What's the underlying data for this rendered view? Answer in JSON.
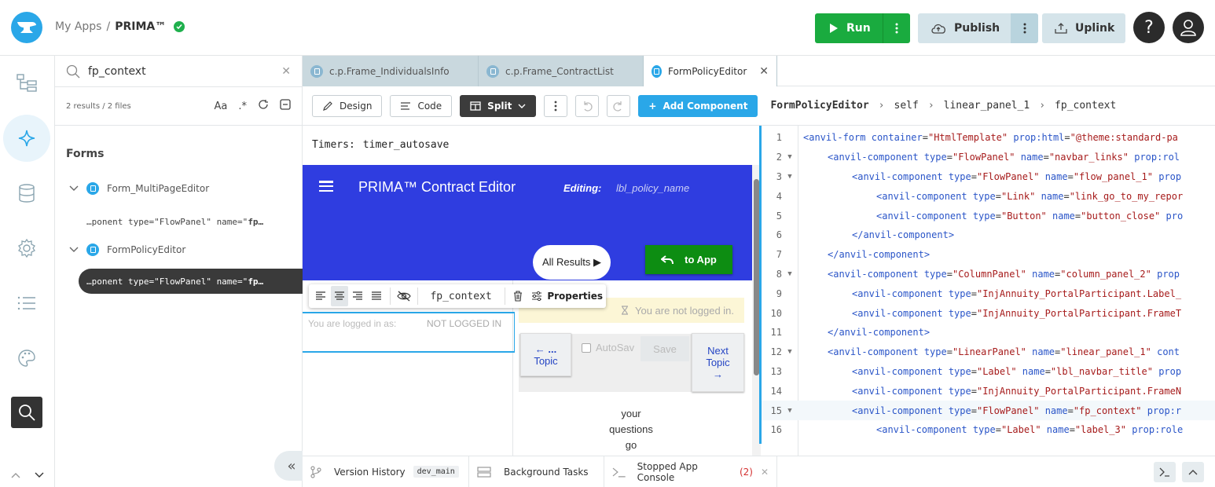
{
  "header": {
    "crumb_root": "My Apps",
    "crumb_sep": "/",
    "app_name": "PRIMA™",
    "run_label": "Run",
    "publish_label": "Publish",
    "uplink_label": "Uplink",
    "help_label": "?"
  },
  "search": {
    "query": "fp_context",
    "meta": "2 results / 2 files",
    "case_label": "Aa",
    "regex_label": ".*"
  },
  "tree": {
    "heading": "Forms",
    "files": [
      {
        "name": "Form_MultiPageEditor",
        "result_prefix": "…ponent type=\"FlowPanel\" name=\"",
        "result_bold": "fp…"
      },
      {
        "name": "FormPolicyEditor",
        "result_prefix": "…ponent type=\"FlowPanel\" name=\"",
        "result_bold": "fp…"
      }
    ]
  },
  "tabs": [
    {
      "label": "c.p.Frame_IndividualsInfo"
    },
    {
      "label": "c.p.Frame_ContractList"
    },
    {
      "label": "FormPolicyEditor"
    }
  ],
  "toolbar": {
    "design": "Design",
    "code": "Code",
    "split": "Split",
    "add_component": "Add Component",
    "path": [
      "FormPolicyEditor",
      "self",
      "linear_panel_1",
      "fp_context"
    ]
  },
  "designer": {
    "timers_label": "Timers:",
    "timers_value": "timer_autosave",
    "nav_title": "PRIMA™ Contract Editor",
    "nav_editing": "Editing:",
    "nav_policy": "lbl_policy_name",
    "all_results": "All Results ▶",
    "to_app": "to App",
    "context_component": "fp_context",
    "properties": "Properties",
    "logged_in_as": "You are logged in as:",
    "not_logged_in": "NOT LOGGED IN",
    "you_not_logged": "You are not logged in.",
    "prev_topic_1": "← ...",
    "prev_topic_2": "Topic",
    "autosave": "AutoSav",
    "save": "Save",
    "next_topic_1": "Next",
    "next_topic_2": "Topic",
    "next_topic_3": "→",
    "questions": [
      "your",
      "questions",
      "go"
    ]
  },
  "code_lines": [
    {
      "n": "1",
      "fold": false,
      "indent": 0,
      "html": "<span class='t'>&lt;anvil-form</span> <span class='a'>container</span>=<span class='s'>\"HtmlTemplate\"</span> <span class='a'>prop:html</span>=<span class='s'>\"@theme:standard-pa</span>"
    },
    {
      "n": "2",
      "fold": true,
      "indent": 1,
      "html": "<span class='t'>&lt;anvil-component</span> <span class='a'>type</span>=<span class='s'>\"FlowPanel\"</span> <span class='a'>name</span>=<span class='s'>\"navbar_links\"</span> <span class='a'>prop:rol</span>"
    },
    {
      "n": "3",
      "fold": true,
      "indent": 2,
      "html": "<span class='t'>&lt;anvil-component</span> <span class='a'>type</span>=<span class='s'>\"FlowPanel\"</span> <span class='a'>name</span>=<span class='s'>\"flow_panel_1\"</span> <span class='a'>prop</span>"
    },
    {
      "n": "4",
      "fold": false,
      "indent": 3,
      "html": "<span class='t'>&lt;anvil-component</span> <span class='a'>type</span>=<span class='s'>\"Link\"</span> <span class='a'>name</span>=<span class='s'>\"link_go_to_my_repor</span>"
    },
    {
      "n": "5",
      "fold": false,
      "indent": 3,
      "html": "<span class='t'>&lt;anvil-component</span> <span class='a'>type</span>=<span class='s'>\"Button\"</span> <span class='a'>name</span>=<span class='s'>\"button_close\"</span> <span class='a'>pro</span>"
    },
    {
      "n": "6",
      "fold": false,
      "indent": 2,
      "html": "<span class='t'>&lt;/anvil-component&gt;</span>"
    },
    {
      "n": "7",
      "fold": false,
      "indent": 1,
      "html": "<span class='t'>&lt;/anvil-component&gt;</span>"
    },
    {
      "n": "8",
      "fold": true,
      "indent": 1,
      "html": "<span class='t'>&lt;anvil-component</span> <span class='a'>type</span>=<span class='s'>\"ColumnPanel\"</span> <span class='a'>name</span>=<span class='s'>\"column_panel_2\"</span> <span class='a'>prop</span>"
    },
    {
      "n": "9",
      "fold": false,
      "indent": 2,
      "html": "<span class='t'>&lt;anvil-component</span> <span class='a'>type</span>=<span class='s'>\"InjAnnuity_PortalParticipant.Label_</span>"
    },
    {
      "n": "10",
      "fold": false,
      "indent": 2,
      "html": "<span class='t'>&lt;anvil-component</span> <span class='a'>type</span>=<span class='s'>\"InjAnnuity_PortalParticipant.FrameT</span>"
    },
    {
      "n": "11",
      "fold": false,
      "indent": 1,
      "html": "<span class='t'>&lt;/anvil-component&gt;</span>"
    },
    {
      "n": "12",
      "fold": true,
      "indent": 1,
      "html": "<span class='t'>&lt;anvil-component</span> <span class='a'>type</span>=<span class='s'>\"LinearPanel\"</span> <span class='a'>name</span>=<span class='s'>\"linear_panel_1\"</span> <span class='a'>cont</span>"
    },
    {
      "n": "13",
      "fold": false,
      "indent": 2,
      "html": "<span class='t'>&lt;anvil-component</span> <span class='a'>type</span>=<span class='s'>\"Label\"</span> <span class='a'>name</span>=<span class='s'>\"lbl_navbar_title\"</span> <span class='a'>prop</span>"
    },
    {
      "n": "14",
      "fold": false,
      "indent": 2,
      "html": "<span class='t'>&lt;anvil-component</span> <span class='a'>type</span>=<span class='s'>\"InjAnnuity_PortalParticipant.FrameN</span>"
    },
    {
      "n": "15",
      "fold": true,
      "indent": 2,
      "cur": true,
      "html": "<span class='t'>&lt;anvil-component</span> <span class='a'>type</span>=<span class='s'>\"FlowPanel\"</span> <span class='a'>name</span>=<span class='s'>\"fp_context\"</span> <span class='a'>prop:r</span>"
    },
    {
      "n": "16",
      "fold": false,
      "indent": 3,
      "html": "<span class='t'>&lt;anvil-component</span> <span class='a'>type</span>=<span class='s'>\"Label\"</span> <span class='a'>name</span>=<span class='s'>\"label_3\"</span> <span class='a'>prop:role</span>"
    }
  ],
  "bottom": {
    "version_history": "Version History",
    "branch": "dev_main",
    "background_tasks": "Background Tasks",
    "console": "Stopped App Console",
    "console_count": "(2)"
  }
}
